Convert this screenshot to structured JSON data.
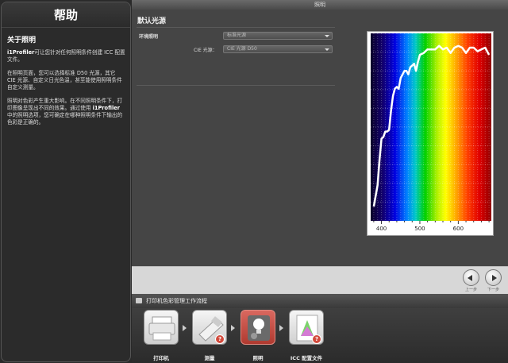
{
  "window": {
    "title": "照明"
  },
  "help": {
    "title": "帮助",
    "subtitle": "关于照明",
    "paragraph1_brand": "i1Profiler",
    "paragraph1_rest": "可让您针对任何照明条件创建 ICC 配置文件。",
    "paragraph2": "在照明页面，您可以选择标准 D50 光源，其它 CIE 光源、自定义日光色温，甚至能使用照明条件自定义测量。",
    "paragraph3_a": "照明对色彩产生重大影响。在不同照明条件下，打印图像呈现出不同的效果。通过使用 ",
    "paragraph3_brand": "i1Profiler",
    "paragraph3_b": " 中的照明选项，您可确定在哪种照明条件下输出的色彩是正确的。"
  },
  "main": {
    "section_title": "默认光源",
    "ambient_label": "环境照明",
    "ambient_value": "标准光源",
    "cie_label": "CIE 光源：",
    "cie_value": "CIE 光源 D50"
  },
  "chart_data": {
    "type": "line",
    "x": [
      380,
      385,
      390,
      395,
      400,
      405,
      410,
      415,
      420,
      425,
      430,
      435,
      440,
      445,
      450,
      455,
      460,
      465,
      470,
      475,
      480,
      485,
      490,
      495,
      500,
      510,
      520,
      530,
      540,
      550,
      560,
      570,
      580,
      590,
      600,
      610,
      620,
      630,
      640,
      650,
      660,
      670,
      680
    ],
    "y": [
      0.08,
      0.14,
      0.2,
      0.34,
      0.46,
      0.47,
      0.5,
      0.5,
      0.51,
      0.62,
      0.7,
      0.74,
      0.75,
      0.74,
      0.8,
      0.82,
      0.84,
      0.84,
      0.82,
      0.86,
      0.87,
      0.88,
      0.84,
      0.89,
      0.93,
      0.94,
      0.96,
      0.96,
      0.96,
      0.98,
      0.96,
      0.97,
      0.94,
      0.97,
      0.98,
      0.97,
      0.94,
      0.97,
      0.97,
      0.95,
      0.96,
      0.97,
      0.93
    ],
    "xlim": [
      372,
      686
    ],
    "ylim": [
      0,
      1.05
    ],
    "x_ticks": [
      400,
      500,
      600
    ],
    "grid": true
  },
  "nav": {
    "prev_label": "上一步",
    "next_label": "下一步"
  },
  "workflow": {
    "title": "打印机色彩管理工作流程",
    "steps": [
      {
        "label": "打印机"
      },
      {
        "label": "测量"
      },
      {
        "label": "照明"
      },
      {
        "label": "ICC 配置文件"
      }
    ]
  },
  "colors": {
    "accent": "#c0443a",
    "panel": "#454545",
    "sidebar": "#2b2b2b"
  }
}
